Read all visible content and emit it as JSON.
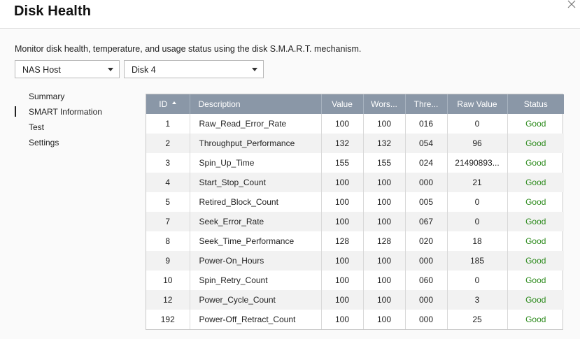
{
  "window": {
    "title": "Disk Health"
  },
  "description": "Monitor disk health, temperature, and usage status using the disk S.M.A.R.T. mechanism.",
  "selects": {
    "host": "NAS Host",
    "disk": "Disk 4"
  },
  "nav": {
    "items": [
      {
        "label": "Summary"
      },
      {
        "label": "SMART Information"
      },
      {
        "label": "Test"
      },
      {
        "label": "Settings"
      }
    ],
    "active": "SMART Information"
  },
  "table": {
    "columns": [
      "ID",
      "Description",
      "Value",
      "Wors...",
      "Thre...",
      "Raw Value",
      "Status"
    ],
    "sort_column": "ID",
    "sort_direction": "ascending",
    "rows": [
      [
        "1",
        "Raw_Read_Error_Rate",
        "100",
        "100",
        "016",
        "0",
        "Good"
      ],
      [
        "2",
        "Throughput_Performance",
        "132",
        "132",
        "054",
        "96",
        "Good"
      ],
      [
        "3",
        "Spin_Up_Time",
        "155",
        "155",
        "024",
        "21490893...",
        "Good"
      ],
      [
        "4",
        "Start_Stop_Count",
        "100",
        "100",
        "000",
        "21",
        "Good"
      ],
      [
        "5",
        "Retired_Block_Count",
        "100",
        "100",
        "005",
        "0",
        "Good"
      ],
      [
        "7",
        "Seek_Error_Rate",
        "100",
        "100",
        "067",
        "0",
        "Good"
      ],
      [
        "8",
        "Seek_Time_Performance",
        "128",
        "128",
        "020",
        "18",
        "Good"
      ],
      [
        "9",
        "Power-On_Hours",
        "100",
        "100",
        "000",
        "185",
        "Good"
      ],
      [
        "10",
        "Spin_Retry_Count",
        "100",
        "100",
        "060",
        "0",
        "Good"
      ],
      [
        "12",
        "Power_Cycle_Count",
        "100",
        "100",
        "000",
        "3",
        "Good"
      ],
      [
        "192",
        "Power-Off_Retract_Count",
        "100",
        "100",
        "000",
        "25",
        "Good"
      ]
    ]
  },
  "colors": {
    "header_bg": "#8a97a7",
    "status_good": "#2e8b1e",
    "row_alt": "#f2f2f2"
  },
  "icons": {
    "close": "close-icon",
    "sort": "sort-ascending-icon",
    "dropdown": "chevron-down-icon"
  }
}
